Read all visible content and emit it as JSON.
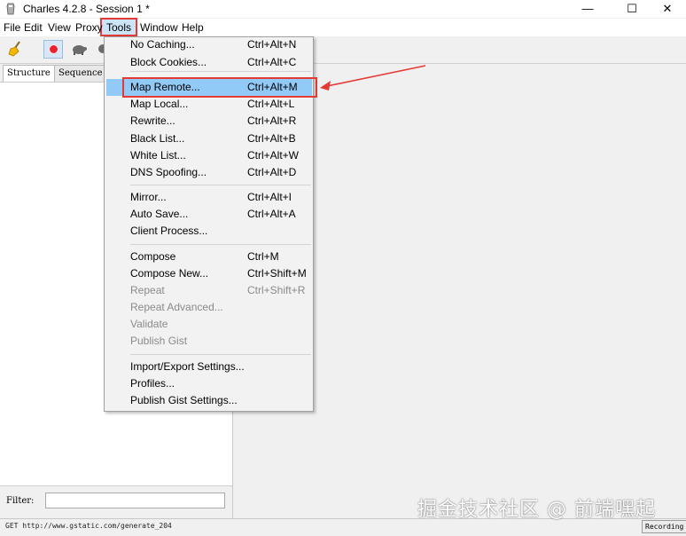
{
  "window": {
    "title": "Charles 4.2.8 - Session 1 *",
    "controls": {
      "minimize": "—",
      "maximize": "☐",
      "close": "✕"
    }
  },
  "menubar": [
    "File",
    "Edit",
    "View",
    "Proxy",
    "Tools",
    "Window",
    "Help"
  ],
  "left_panel": {
    "tabs": [
      "Structure",
      "Sequence"
    ],
    "filter_label": "Filter:",
    "filter_value": ""
  },
  "tools_menu": {
    "groups": [
      [
        {
          "label": "No Caching...",
          "shortcut": "Ctrl+Alt+N"
        },
        {
          "label": "Block Cookies...",
          "shortcut": "Ctrl+Alt+C"
        }
      ],
      [
        {
          "label": "Map Remote...",
          "shortcut": "Ctrl+Alt+M",
          "highlighted": true
        },
        {
          "label": "Map Local...",
          "shortcut": "Ctrl+Alt+L"
        },
        {
          "label": "Rewrite...",
          "shortcut": "Ctrl+Alt+R"
        },
        {
          "label": "Black List...",
          "shortcut": "Ctrl+Alt+B"
        },
        {
          "label": "White List...",
          "shortcut": "Ctrl+Alt+W"
        },
        {
          "label": "DNS Spoofing...",
          "shortcut": "Ctrl+Alt+D"
        }
      ],
      [
        {
          "label": "Mirror...",
          "shortcut": "Ctrl+Alt+I"
        },
        {
          "label": "Auto Save...",
          "shortcut": "Ctrl+Alt+A"
        },
        {
          "label": "Client Process...",
          "shortcut": ""
        }
      ],
      [
        {
          "label": "Compose",
          "shortcut": "Ctrl+M"
        },
        {
          "label": "Compose New...",
          "shortcut": "Ctrl+Shift+M"
        },
        {
          "label": "Repeat",
          "shortcut": "Ctrl+Shift+R",
          "disabled": true
        },
        {
          "label": "Repeat Advanced...",
          "shortcut": "",
          "disabled": true
        },
        {
          "label": "Validate",
          "shortcut": "",
          "disabled": true
        },
        {
          "label": "Publish Gist",
          "shortcut": "",
          "disabled": true
        }
      ],
      [
        {
          "label": "Import/Export Settings...",
          "shortcut": ""
        },
        {
          "label": "Profiles...",
          "shortcut": ""
        },
        {
          "label": "Publish Gist Settings...",
          "shortcut": ""
        }
      ]
    ]
  },
  "statusbar": {
    "text": "GET http://www.gstatic.com/generate_204",
    "recording": "Recording"
  },
  "watermark": "掘金技术社区 @ 前端嘿起",
  "colors": {
    "annotation_red": "#e53935",
    "menu_highlight": "#91c9f7",
    "record_red": "#e8222e"
  }
}
